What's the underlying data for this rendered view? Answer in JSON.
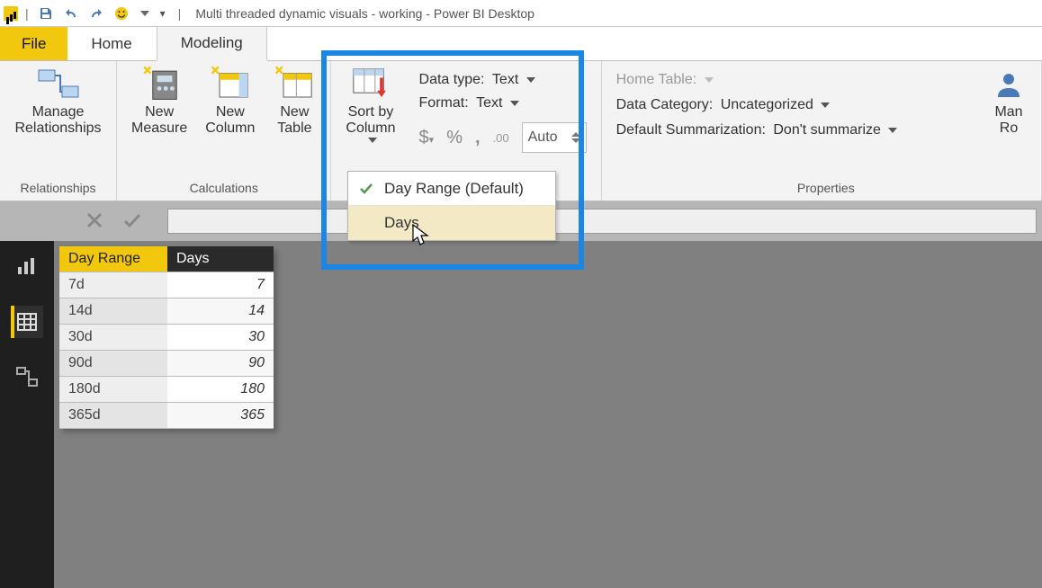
{
  "titlebar": {
    "app_title": "Multi threaded dynamic visuals - working - Power BI Desktop"
  },
  "tabs": {
    "file": "File",
    "home": "Home",
    "modeling": "Modeling"
  },
  "ribbon": {
    "relationships": {
      "manage": "Manage\nRelationships",
      "group_label": "Relationships"
    },
    "calculations": {
      "new_measure": "New\nMeasure",
      "new_column": "New\nColumn",
      "new_table": "New\nTable",
      "group_label": "Calculations"
    },
    "sort": {
      "label": "Sort by\nColumn"
    },
    "formatting": {
      "data_type_label": "Data type:",
      "data_type_value": "Text",
      "format_label": "Format:",
      "format_value": "Text",
      "auto": "Auto"
    },
    "properties": {
      "home_table": "Home Table:",
      "data_category_label": "Data Category:",
      "data_category_value": "Uncategorized",
      "default_sum_label": "Default Summarization:",
      "default_sum_value": "Don't summarize",
      "group_label": "Properties",
      "manage_roles": "Man\nRo"
    }
  },
  "dropdown": {
    "item1": "Day Range (Default)",
    "item2": "Days"
  },
  "table": {
    "headerA": "Day Range",
    "headerB": "Days",
    "rows": [
      {
        "range": "7d",
        "days": "7"
      },
      {
        "range": "14d",
        "days": "14"
      },
      {
        "range": "30d",
        "days": "30"
      },
      {
        "range": "90d",
        "days": "90"
      },
      {
        "range": "180d",
        "days": "180"
      },
      {
        "range": "365d",
        "days": "365"
      }
    ]
  }
}
